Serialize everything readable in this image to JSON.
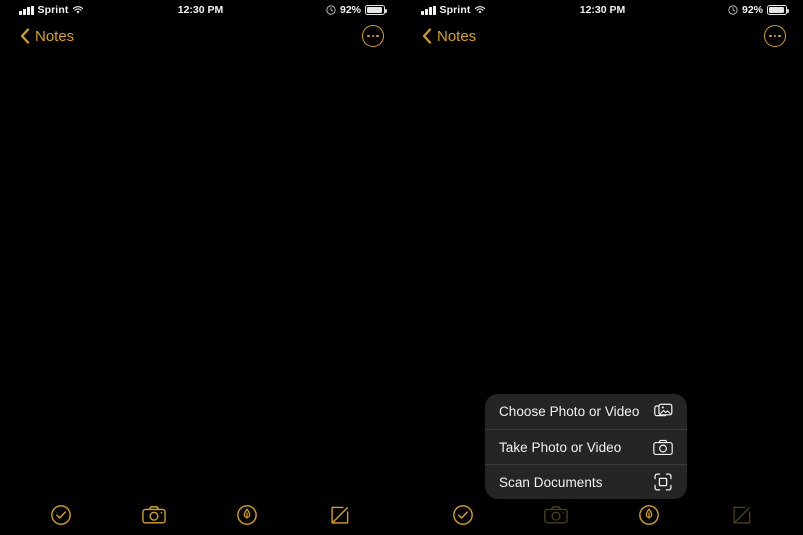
{
  "accent_color": "#d8a417",
  "accent_dimmed_color": "#4a3f16",
  "menu_background_color": "#252525",
  "screen_background_color": "#000000",
  "status_bar": {
    "carrier": "Sprint",
    "time": "12:30 PM",
    "battery_percent": "92%",
    "signal_icon": "signal-bars-icon",
    "wifi_icon": "wifi-icon",
    "alarm_icon": "alarm-clock-icon",
    "battery_icon": "battery-icon"
  },
  "nav_bar": {
    "back_label": "Notes",
    "back_icon": "chevron-left-icon",
    "more_icon": "more-options-icon"
  },
  "toolbar": {
    "items": [
      {
        "name": "checklist-icon",
        "label": "Checklist"
      },
      {
        "name": "camera-icon",
        "label": "Camera"
      },
      {
        "name": "markup-icon",
        "label": "Markup"
      },
      {
        "name": "compose-icon",
        "label": "Compose"
      }
    ]
  },
  "context_menu": {
    "items": [
      {
        "label": "Choose Photo or Video",
        "icon": "photo-library-icon"
      },
      {
        "label": "Take Photo or Video",
        "icon": "camera-icon"
      },
      {
        "label": "Scan Documents",
        "icon": "document-scanner-icon"
      }
    ]
  }
}
